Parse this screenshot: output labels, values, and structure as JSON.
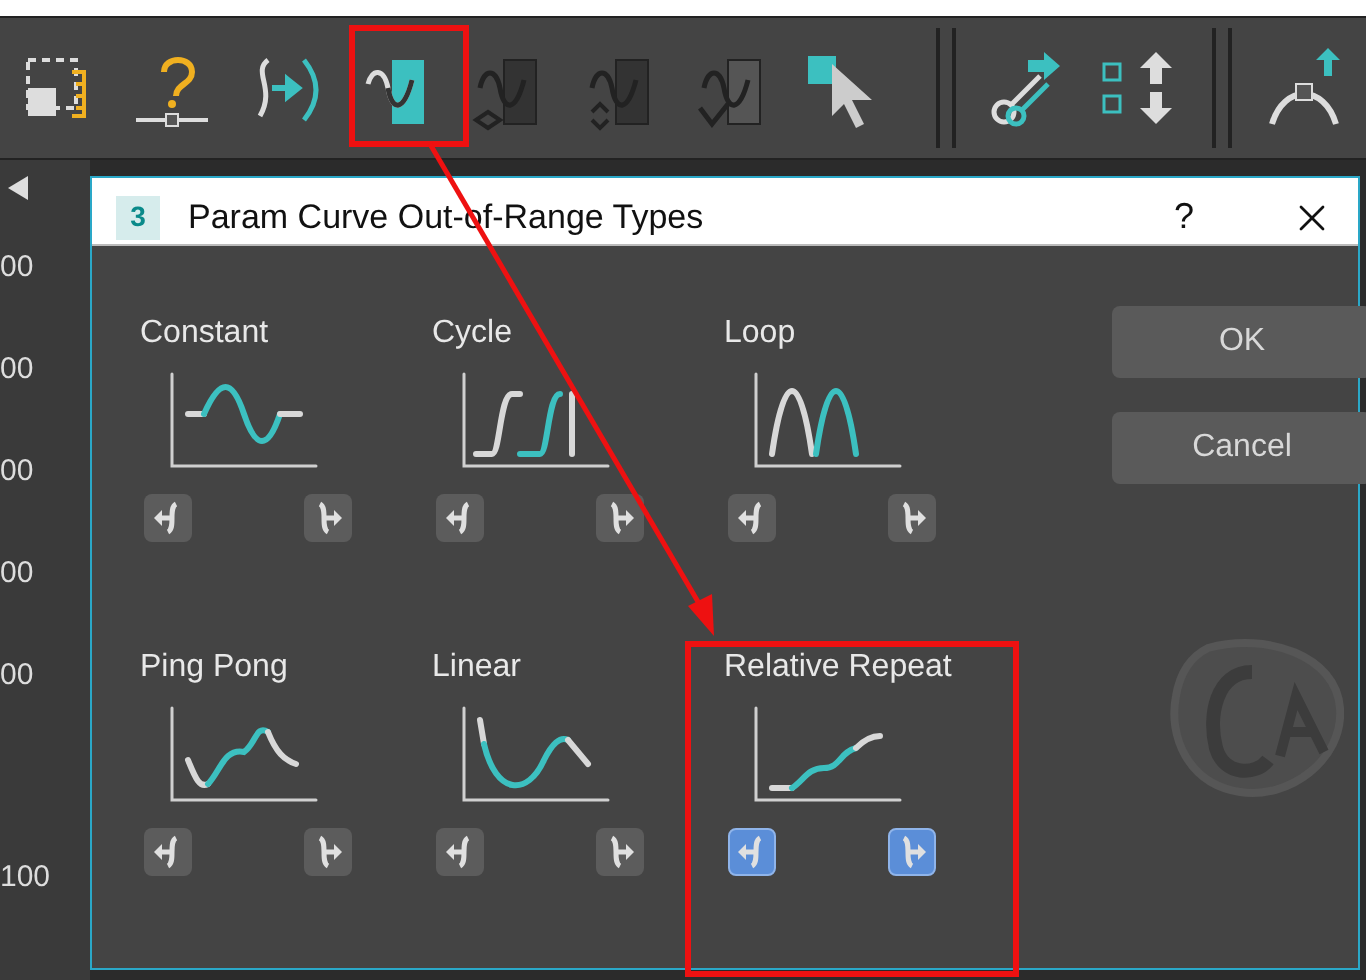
{
  "ruler": {
    "labels": [
      "00",
      "00",
      "00",
      "00",
      "00",
      "100"
    ]
  },
  "dialog": {
    "title": "Param Curve Out-of-Range Types",
    "badge": "3",
    "help": "?",
    "types": [
      {
        "label": "Constant",
        "kind": "constant",
        "before_selected": false,
        "after_selected": false
      },
      {
        "label": "Cycle",
        "kind": "cycle",
        "before_selected": false,
        "after_selected": false
      },
      {
        "label": "Loop",
        "kind": "loop",
        "before_selected": false,
        "after_selected": false
      },
      {
        "label": "Ping Pong",
        "kind": "pingpong",
        "before_selected": false,
        "after_selected": false
      },
      {
        "label": "Linear",
        "kind": "linear",
        "before_selected": false,
        "after_selected": false
      },
      {
        "label": "Relative Repeat",
        "kind": "relative",
        "before_selected": true,
        "after_selected": true
      }
    ],
    "buttons": [
      "OK",
      "Cancel"
    ]
  }
}
